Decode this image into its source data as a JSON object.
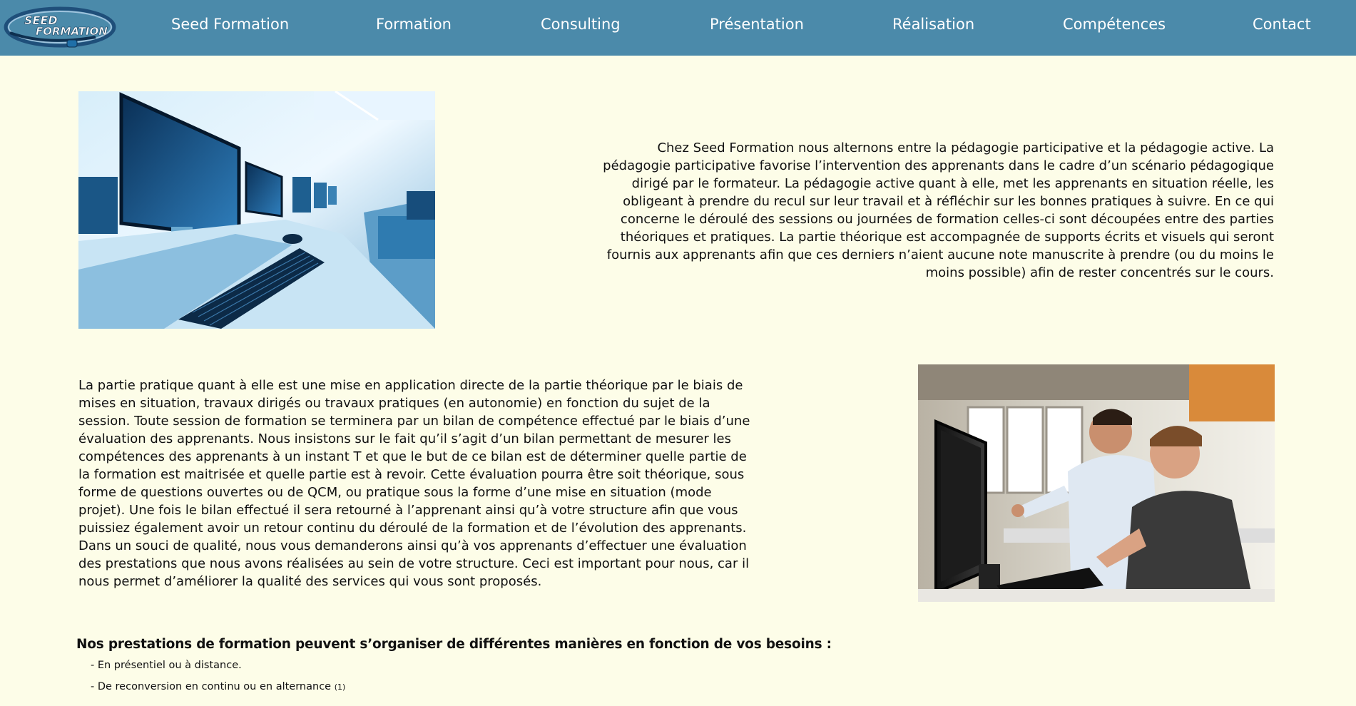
{
  "header": {
    "logo_line1": "SEED",
    "logo_line2": "FORMATION",
    "nav": [
      {
        "label": "Seed Formation"
      },
      {
        "label": "Formation"
      },
      {
        "label": "Consulting"
      },
      {
        "label": "Présentation"
      },
      {
        "label": "Réalisation"
      },
      {
        "label": "Compétences"
      },
      {
        "label": "Contact"
      }
    ]
  },
  "main": {
    "paragraph1": "Chez Seed Formation nous alternons entre la pédagogie participative et la pédagogie active. La pédagogie participative favorise l’intervention des apprenants dans le cadre d’un scénario pédagogique dirigé par le formateur. La pédagogie active quant à elle, met les apprenants en situation réelle, les obligeant à prendre du recul sur leur travail et à réfléchir sur les bonnes pratiques à suivre. En ce qui concerne le déroulé des sessions ou journées de formation celles-ci sont découpées entre des parties théoriques et pratiques. La partie théorique est accompagnée de supports écrits et visuels qui seront fournis aux apprenants afin que ces derniers n’aient aucune note manuscrite à prendre (ou du moins le moins possible) afin de rester concentrés sur le cours.",
    "paragraph2": "La partie pratique quant à elle est une mise en application directe de la partie théorique par le biais de mises en situation, travaux dirigés ou travaux pratiques (en autonomie) en fonction du sujet de la session. Toute session de formation se terminera par un bilan de compétence effectué par le biais d’une évaluation des apprenants. Nous insistons sur le fait qu’il s’agit d’un bilan permettant de mesurer les compétences des apprenants à un instant T et que le but de ce bilan est de déterminer quelle partie de la formation est maitrisée et quelle partie est à revoir. Cette évaluation pourra être soit théorique, sous forme de questions ouvertes ou de QCM, ou pratique sous la forme d’une mise en situation (mode projet). Une fois le bilan effectué il sera retourné à l’apprenant ainsi qu’à votre structure afin que vous puissiez également avoir un retour continu du déroulé de la formation et de l’évolution des apprenants. Dans un souci de qualité, nous vous demanderons ainsi qu’à vos apprenants d’effectuer une évaluation des prestations que nous avons réalisées au sein de votre structure. Ceci est important pour nous, car il nous permet d’améliorer la qualité des services qui vous sont proposés.",
    "services_heading": "Nos prestations de formation peuvent s’organiser de différentes manières en fonction de vos besoins :",
    "services": [
      {
        "text": "- En présentiel ou à distance.",
        "note": ""
      },
      {
        "text": "- De reconversion en continu ou en alternance",
        "note": "(1)"
      }
    ]
  },
  "colors": {
    "navbar": "#4b8aaa",
    "background": "#fdfde8",
    "nav_text": "#ffffff"
  }
}
